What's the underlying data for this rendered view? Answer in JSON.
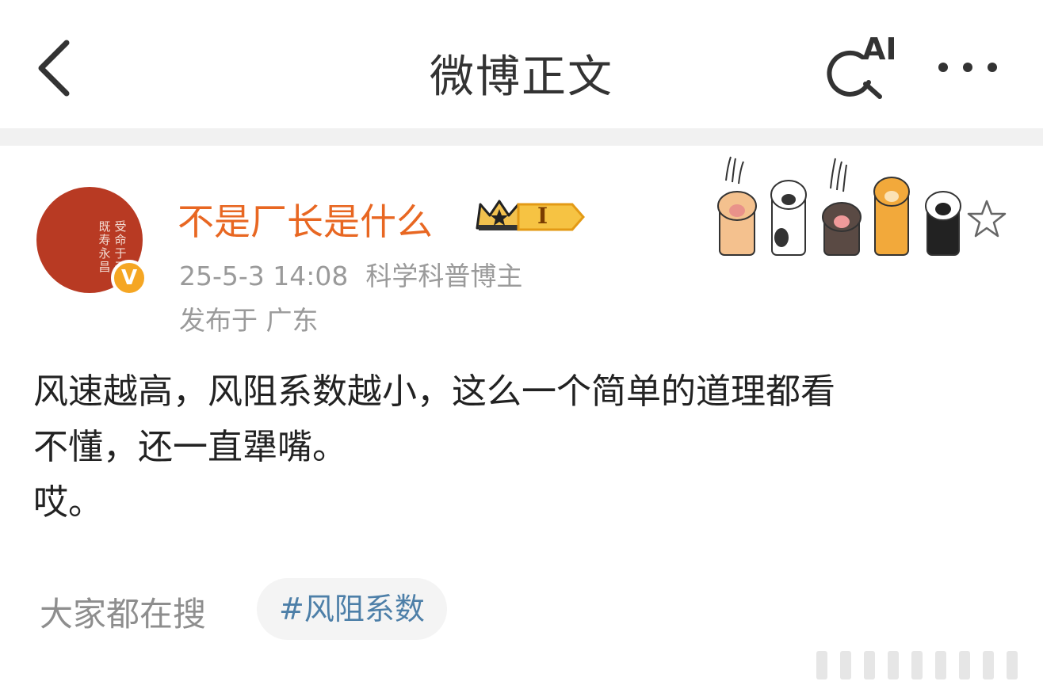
{
  "header": {
    "title": "微博正文",
    "ai_label": "AI"
  },
  "post": {
    "author": {
      "name": "不是厂长是什么",
      "avatar_text": "受命于天\n既寿永昌",
      "verified_mark": "V",
      "level_badge": "I"
    },
    "timestamp": "25-5-3 14:08",
    "category": "科学科普博主",
    "location": "发布于 广东",
    "body": "风速越高，风阻系数越小，这么一个简单的道理都看\n不懂，还一直犟嘴。\n哎。"
  },
  "related_search": {
    "label": "大家都在搜",
    "tags": [
      "#风阻系数"
    ]
  },
  "colors": {
    "username": "#e86722",
    "hashtag": "#4d7fa8",
    "avatar_bg": "#b83a23",
    "verified": "#f5a623",
    "meta_text": "#9a9a9a"
  },
  "icons": {
    "back": "chevron-left-icon",
    "ai_search": "ai-search-icon",
    "more": "ellipsis-icon",
    "crown": "crown-icon",
    "star": "star-outline-icon",
    "paws": "cat-paws-decoration-icon"
  }
}
